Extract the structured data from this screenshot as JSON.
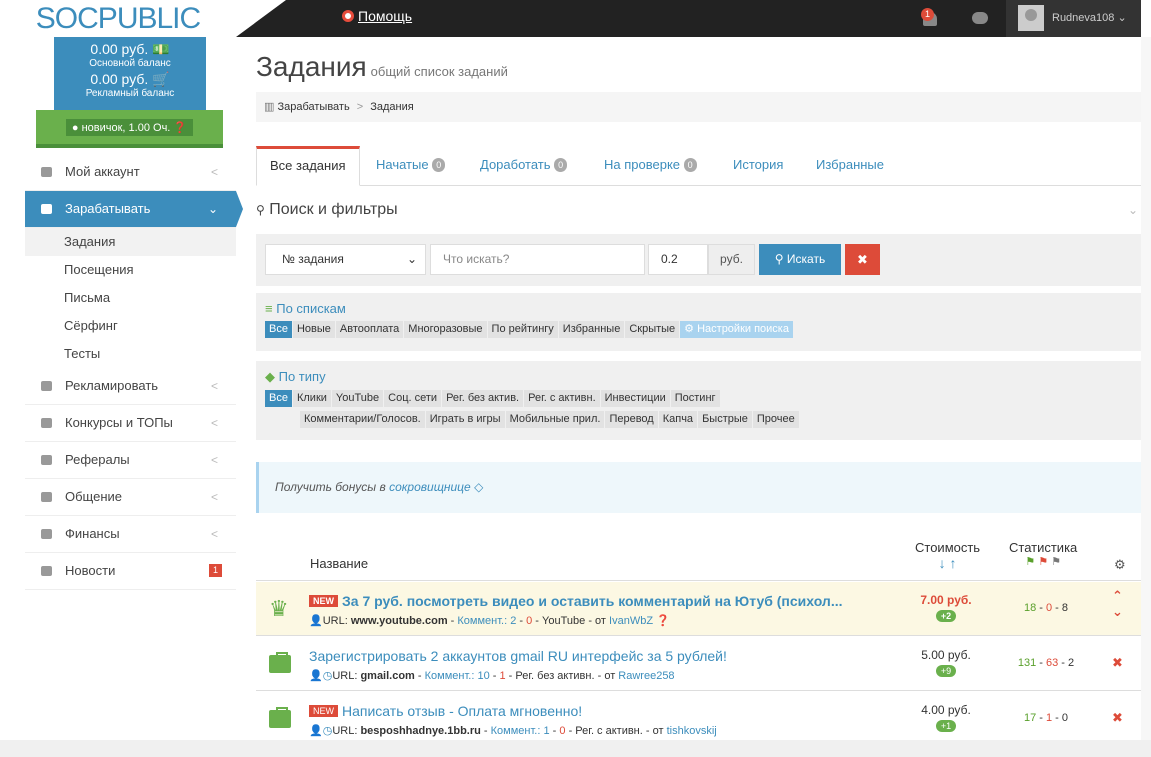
{
  "topbar": {
    "logo": "SOCPUBLIC",
    "help": "Помощь",
    "notif_count": "1",
    "username": "Rudneva108 ⌄"
  },
  "balance": {
    "main_amount": "0.00 руб. 💵",
    "main_label": "Основной баланс",
    "ad_amount": "0.00 руб. 🛒",
    "ad_label": "Рекламный баланс",
    "rank": "● новичок, 1.00 Оч. ❓"
  },
  "menu": {
    "account": "Мой аккаунт",
    "earn": "Зарабатывать",
    "earn_sub": [
      "Задания",
      "Посещения",
      "Письма",
      "Сёрфинг",
      "Тесты"
    ],
    "advertise": "Рекламировать",
    "contests": "Конкурсы и ТОПы",
    "referrals": "Рефералы",
    "chat": "Общение",
    "finance": "Финансы",
    "news": "Новости",
    "news_badge": "1"
  },
  "page": {
    "title": "Задания",
    "subtitle": "общий список заданий",
    "bc_1": "Зарабатывать",
    "bc_sep": ">",
    "bc_2": "Задания"
  },
  "tabs": {
    "all": "Все задания",
    "started": "Начатые",
    "started_cnt": "0",
    "rework": "Доработать",
    "rework_cnt": "0",
    "review": "На проверке",
    "review_cnt": "0",
    "history": "История",
    "fav": "Избранные"
  },
  "search": {
    "title": "Поиск и фильтры",
    "select_value": "№ задания",
    "query_placeholder": "Что искать?",
    "price": "0.2",
    "currency": "руб.",
    "search_button": "Искать",
    "clear_button": "✖"
  },
  "lists": {
    "title": "По спискам",
    "tags": [
      "Все",
      "Новые",
      "Автооплата",
      "Многоразовые",
      "По рейтингу",
      "Избранные",
      "Скрытые"
    ],
    "settings": "Настройки поиска"
  },
  "types": {
    "title": "По типу",
    "row1": [
      "Все",
      "Клики",
      "YouTube",
      "Соц. сети",
      "Рег. без актив.",
      "Рег. с активн.",
      "Инвестиции",
      "Постинг"
    ],
    "row2": [
      "Комментарии/Голосов.",
      "Играть в игры",
      "Мобильные прил.",
      "Перевод",
      "Капча",
      "Быстрые",
      "Прочее"
    ]
  },
  "bonus": {
    "text": "Получить бонусы в",
    "link": "сокровищнице"
  },
  "table": {
    "col_name": "Название",
    "col_cost": "Стоимость",
    "col_stat": "Статистика"
  },
  "rows": [
    {
      "new": "NEW",
      "title": "За 7 руб. посмотреть видео и оставить комментарий на Ютуб (психол...",
      "url_label": "URL:",
      "url": "www.youtube.com",
      "comm_label": "Коммент.:",
      "c_g": "2",
      "c_r": "0",
      "type": "YouTube",
      "from": "от",
      "author": "IvanWbZ",
      "price": "7.00 руб.",
      "pill": "+2",
      "s_g": "18",
      "s_r": "0",
      "s_n": "8"
    },
    {
      "new": "",
      "title": "Зарегистрировать 2 аккаунтов gmail RU интерфейс за 5 рублей!",
      "url_label": "URL:",
      "url": "gmail.com",
      "comm_label": "Коммент.:",
      "c_g": "10",
      "c_r": "1",
      "type": "Рег. без активн.",
      "from": "от",
      "author": "Rawree258",
      "price": "5.00 руб.",
      "pill": "+9",
      "s_g": "131",
      "s_r": "63",
      "s_n": "2"
    },
    {
      "new": "NEW",
      "title": "Написать отзыв - Оплата мгновенно!",
      "url_label": "URL:",
      "url": "besposhhadnye.1bb.ru",
      "comm_label": "Коммент.:",
      "c_g": "1",
      "c_r": "0",
      "type": "Рег. с активн.",
      "from": "от",
      "author": "tishkovskij",
      "price": "4.00 руб.",
      "pill": "+1",
      "s_g": "17",
      "s_r": "1",
      "s_n": "0"
    }
  ]
}
